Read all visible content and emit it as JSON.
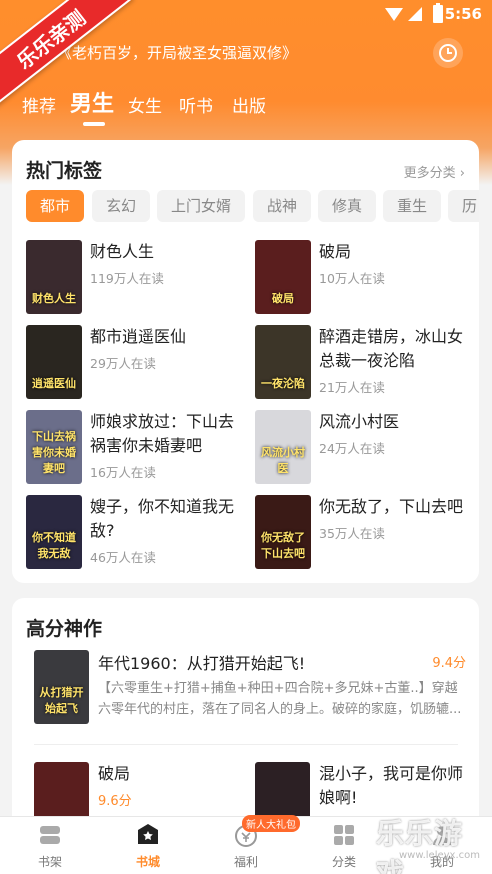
{
  "status": {
    "time": "5:56"
  },
  "badge": {
    "text": "乐乐亲测"
  },
  "search": {
    "text": "《老朽百岁，开局被圣女强逼双修》",
    "icon": "history-clock-icon"
  },
  "tabs": [
    "推荐",
    "男生",
    "女生",
    "听书",
    "出版"
  ],
  "hot": {
    "title": "热门标签",
    "more": "更多分类",
    "chips": [
      "都市",
      "玄幻",
      "上门女婿",
      "战神",
      "修真",
      "重生",
      "历"
    ],
    "books": [
      {
        "title": "财色人生",
        "reads": "119万人在读",
        "cover_text": "财色人生",
        "cover_color": "#3a2a2e"
      },
      {
        "title": "破局",
        "reads": "10万人在读",
        "cover_text": "破局",
        "cover_color": "#5a1e1e"
      },
      {
        "title": "都市逍遥医仙",
        "reads": "29万人在读",
        "cover_text": "逍遥医仙",
        "cover_color": "#2a2620"
      },
      {
        "title": "醉酒走错房，冰山女总裁一夜沦陷",
        "reads": "21万人在读",
        "cover_text": "一夜沦陷",
        "cover_color": "#3c3528"
      },
      {
        "title": "师娘求放过：下山去祸害你未婚妻吧",
        "reads": "16万人在读",
        "cover_text": "下山去祸害你未婚妻吧",
        "cover_color": "#6b6e8a"
      },
      {
        "title": "风流小村医",
        "reads": "24万人在读",
        "cover_text": "风流小村医",
        "cover_color": "#d8d8dc"
      },
      {
        "title": "嫂子，你不知道我无敌?",
        "reads": "46万人在读",
        "cover_text": "你不知道我无敌",
        "cover_color": "#2a2840"
      },
      {
        "title": "你无敌了，下山去吧",
        "reads": "35万人在读",
        "cover_text": "你无敌了下山去吧",
        "cover_color": "#3a1a16"
      }
    ]
  },
  "top": {
    "title": "高分神作",
    "highlight": {
      "title": "年代1960：从打猎开始起飞!",
      "score": "9.4分",
      "desc": "【六零重生+打猎+捕鱼+种田+四合院+多兄妹+古董..】穿越六零年代的村庄，落在了同名人的身上。破碎的家庭，饥肠辘...",
      "cover_text": "从打猎开始起飞",
      "cover_color": "#3a3a3e"
    },
    "books": [
      {
        "title": "破局",
        "score": "9.6分",
        "cover_color": "#5a1e1e"
      },
      {
        "title": "混小子，我可是你师娘啊!",
        "score": "",
        "cover_color": "#2c2024"
      }
    ]
  },
  "nav": {
    "items": [
      "书架",
      "书城",
      "福利",
      "分类",
      "我的"
    ],
    "gift": "新人大礼包"
  },
  "watermark": {
    "text": "乐乐游戏",
    "url": "www.leleyx.com"
  },
  "colors": {
    "accent": "#ff8b2c"
  }
}
